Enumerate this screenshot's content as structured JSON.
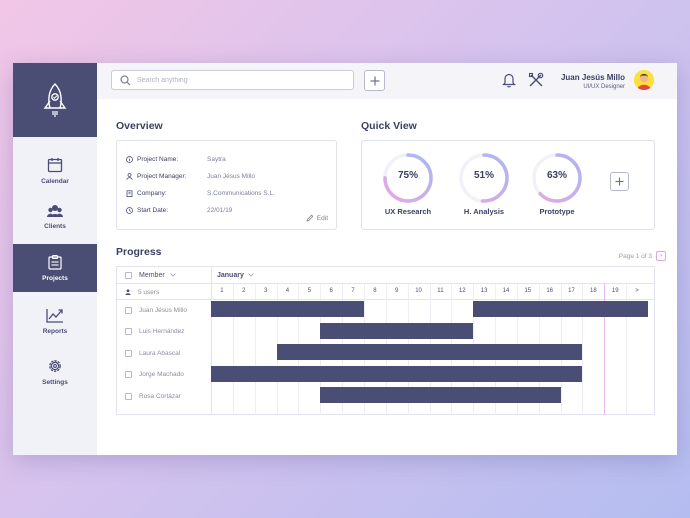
{
  "colors": {
    "primary": "#4a4e74",
    "accent": "#c7a3ea",
    "sidebar_bg": "#f1f2f8"
  },
  "sidebar": {
    "logo": "rocket-icon",
    "items": [
      {
        "label": "Calendar",
        "icon": "calendar-icon",
        "active": false
      },
      {
        "label": "Clients",
        "icon": "clients-icon",
        "active": false
      },
      {
        "label": "Projects",
        "icon": "projects-icon",
        "active": true
      },
      {
        "label": "Reports",
        "icon": "reports-icon",
        "active": false
      },
      {
        "label": "Settings",
        "icon": "settings-icon",
        "active": false
      }
    ]
  },
  "topbar": {
    "search_placeholder": "Search anything",
    "user_name": "Juan Jesús Millo",
    "user_role": "UI/UX Designer"
  },
  "overview": {
    "title": "Overview",
    "rows": [
      {
        "label": "Project Name:",
        "value": "Saytra",
        "icon": "info-icon"
      },
      {
        "label": "Project Manager:",
        "value": "Juan Jésus Millo",
        "icon": "manager-icon"
      },
      {
        "label": "Company:",
        "value": "S.Communications S.L.",
        "icon": "building-icon"
      },
      {
        "label": "Start Date:",
        "value": "22/01/19",
        "icon": "clock-icon"
      }
    ],
    "edit_label": "Edit"
  },
  "quick_view": {
    "title": "Quick View",
    "gauges": [
      {
        "label": "UX Research",
        "percent_text": "75%",
        "value": 0.75
      },
      {
        "label": "H. Analysis",
        "percent_text": "51%",
        "value": 0.51
      },
      {
        "label": "Prototype",
        "percent_text": "63%",
        "value": 0.63
      }
    ]
  },
  "progress": {
    "title": "Progress",
    "pager": "Page 1 of 3",
    "member_header": "Member",
    "month": "January",
    "users_label": "5 users",
    "days": [
      "1",
      "2",
      "3",
      "4",
      "5",
      "6",
      "7",
      "8",
      "9",
      "10",
      "11",
      "12",
      "13",
      "14",
      "15",
      "16",
      "17",
      "18",
      "19",
      ">"
    ],
    "members": [
      {
        "name": "Juan Jésus Millo",
        "segments": [
          [
            1,
            7
          ],
          [
            13,
            20
          ]
        ]
      },
      {
        "name": "Luis Hernández",
        "segments": [
          [
            6,
            12
          ]
        ]
      },
      {
        "name": "Laura Abascal",
        "segments": [
          [
            4,
            17
          ]
        ]
      },
      {
        "name": "Jorge Machado",
        "segments": [
          [
            1,
            17
          ]
        ]
      },
      {
        "name": "Rosa Cortázar",
        "segments": [
          [
            6,
            16
          ]
        ]
      }
    ]
  }
}
